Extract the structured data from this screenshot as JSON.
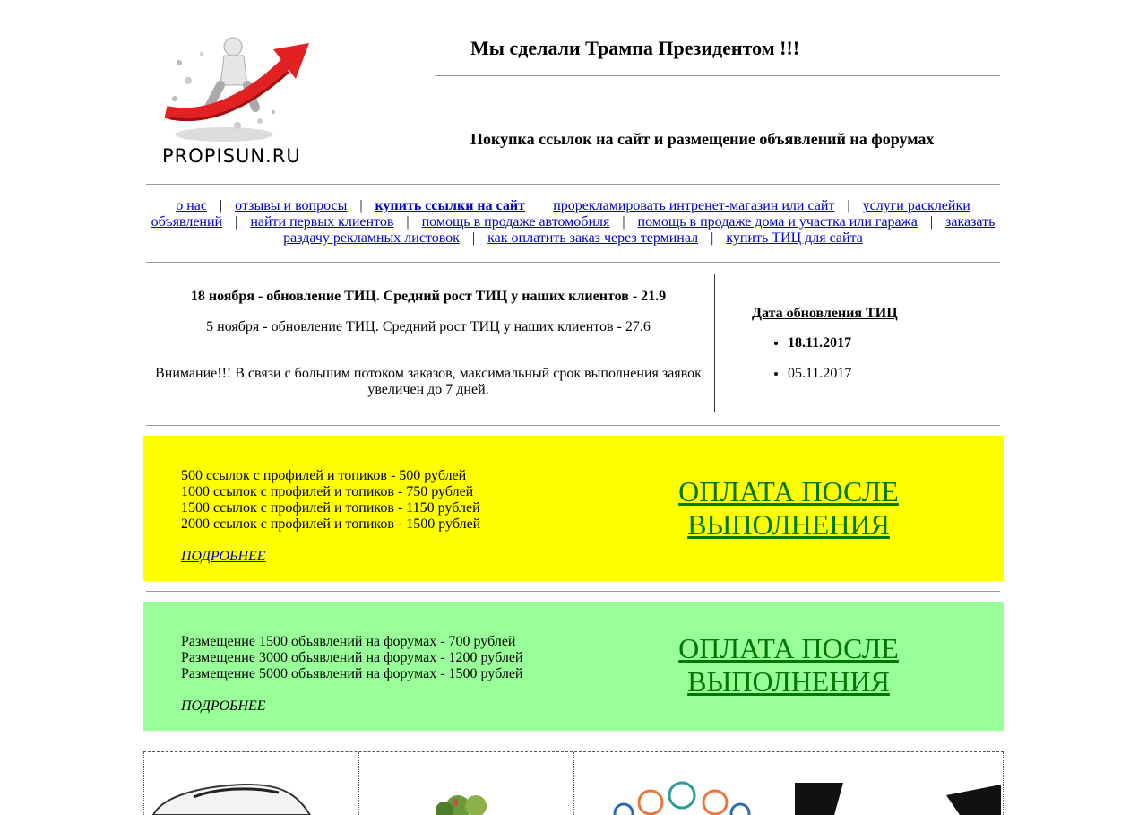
{
  "header": {
    "logo_text": "PROPISUN.RU",
    "headline": "Мы сделали Трампа Президентом !!!",
    "subline": "Покупка ссылок на сайт и размещение объявлений на форумах"
  },
  "nav": {
    "items": [
      {
        "label": "о нас"
      },
      {
        "label": "отзывы и вопросы"
      },
      {
        "label": "купить ссылки на сайт",
        "bold": true
      },
      {
        "label": "прорекламировать интренет-магазин или сайт"
      },
      {
        "label": "услуги расклейки объявлений"
      },
      {
        "label": "найти первых клиентов"
      },
      {
        "label": "помощь в продаже автомобиля"
      },
      {
        "label": " помощь в продаже дома и участка или гаража"
      },
      {
        "label": "заказать раздачу рекламных листовок"
      },
      {
        "label": "как оплатить заказ через терминал"
      },
      {
        "label": "купить ТИЦ для сайта"
      }
    ],
    "separator": "|"
  },
  "news": {
    "item1": "18 ноября - обновление ТИЦ. Средний рост ТИЦ у наших клиентов - 21.9",
    "item2": "5 ноября - обновление ТИЦ. Средний рост ТИЦ у наших клиентов - 27.6",
    "notice": "Внимание!!! В связи с большим потоком заказов, максимальный срок выполнения заявок увеличен до 7 дней."
  },
  "dates": {
    "title": "Дата обновления ТИЦ",
    "items": [
      "18.11.2017",
      "05.11.2017"
    ]
  },
  "offer_links": {
    "lines": [
      "500 ссылок с профилей и топиков - 500 рублей",
      "1000 ссылок с профилей и топиков - 750 рублей",
      "1500 ссылок с профилей и топиков - 1150 рублей",
      "2000 ссылок с профилей и топиков - 1500 рублей"
    ],
    "more": "ПОДРОБНЕЕ",
    "pay": "ОПЛАТА ПОСЛЕ ВЫПОЛНЕНИЯ",
    "bg": "#ffff00"
  },
  "offer_forums": {
    "lines": [
      "Размещение 1500 объявлений на форумах - 700 рублей",
      "Размещение 3000 объявлений на форумах - 1200 рублей",
      "Размещение 5000 объявлений на форумах - 1500 рублей"
    ],
    "more": "ПОДРОБНЕЕ",
    "pay": "ОПЛАТА ПОСЛЕ ВЫПОЛНЕНИЯ",
    "bg": "#99ff99"
  },
  "colors": {
    "link": "#0000cc",
    "pay_text": "#007700",
    "logo_arrow": "#e22222"
  },
  "grid_icons": [
    "car-image",
    "house-image",
    "marketing-icons-image",
    "black-product-image"
  ]
}
